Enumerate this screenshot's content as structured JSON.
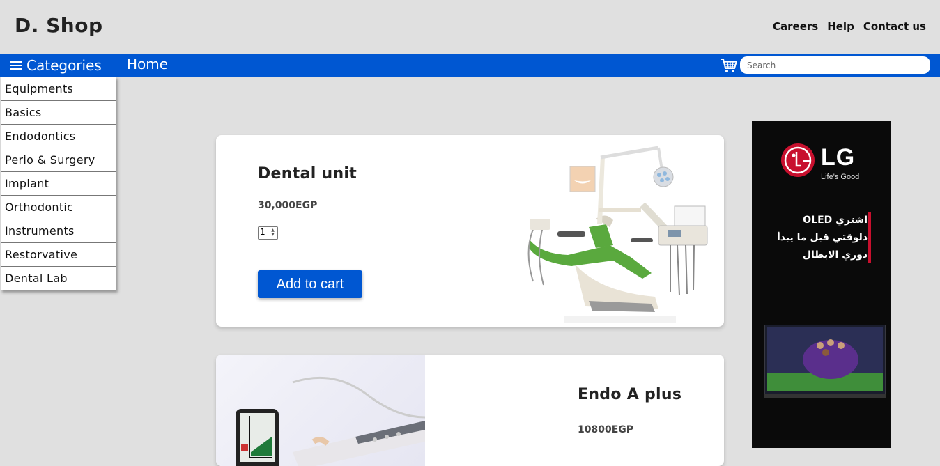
{
  "header": {
    "brand": "D. Shop",
    "links": [
      "Careers",
      "Help",
      "Contact us"
    ]
  },
  "nav": {
    "categories_label": "Categories",
    "home_label": "Home",
    "search_placeholder": "Search"
  },
  "sidebar": {
    "items": [
      "Equipments",
      "Basics",
      "Endodontics",
      "Perio & Surgery",
      "Implant",
      "Orthodontic",
      "Instruments",
      "Restorvative",
      "Dental Lab"
    ]
  },
  "products": [
    {
      "title": "Dental unit",
      "price": "30,000EGP",
      "qty": "1",
      "button": "Add to cart"
    },
    {
      "title": "Endo A plus",
      "price": "10800EGP"
    }
  ],
  "ad": {
    "brand": "LG",
    "tagline": "Life's Good",
    "lines": [
      "اشتري OLED",
      "دلوقتي قبل ما يبدأ",
      "دوري الابطال"
    ],
    "accent": "#c8102e"
  },
  "colors": {
    "primary": "#0057d2",
    "background": "#e0e0e0"
  }
}
